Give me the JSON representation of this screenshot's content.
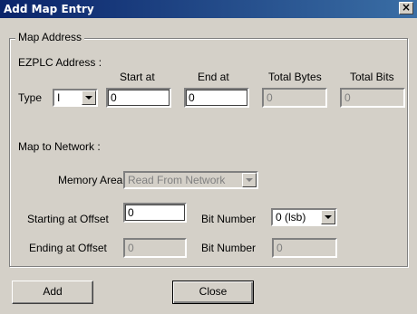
{
  "window": {
    "title": "Add Map Entry",
    "close_glyph": "×"
  },
  "map_address": {
    "group_label": "Map Address",
    "ezplc_label": "EZPLC Address :",
    "col_start": "Start at",
    "col_end": "End at",
    "col_total_bytes": "Total Bytes",
    "col_total_bits": "Total Bits",
    "type_label": "Type",
    "type_value": "I",
    "start_value": "0",
    "end_value": "0",
    "total_bytes_value": "0",
    "total_bits_value": "0",
    "map_to_network_label": "Map to Network :",
    "memory_area_label": "Memory Area",
    "memory_area_value": "Read From Network",
    "starting_offset_label": "Starting at Offset",
    "starting_offset_value": "0",
    "bit_number_label": "Bit Number",
    "bit_number_value": "0 (lsb)",
    "ending_offset_label": "Ending at Offset",
    "ending_offset_value": "0",
    "bit_number2_label": "Bit Number",
    "bit_number2_value": "0"
  },
  "buttons": {
    "add": "Add",
    "close": "Close"
  },
  "icons": {
    "dropdown": "chevron-down-icon",
    "close": "close-icon"
  },
  "colors": {
    "titlebar": "#0a246a",
    "face": "#d4d0c8"
  }
}
